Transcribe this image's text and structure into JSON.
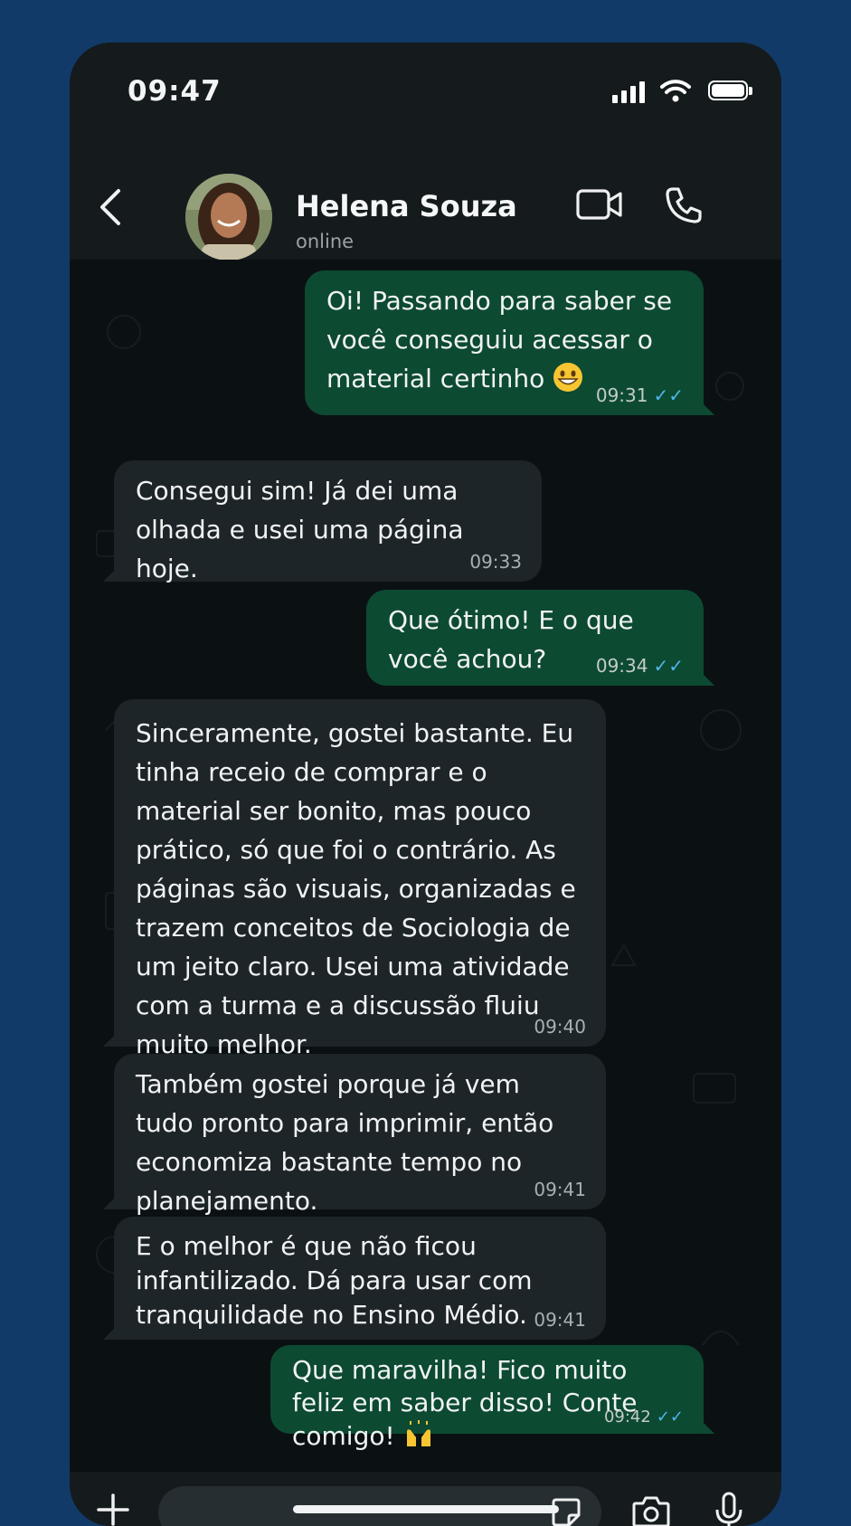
{
  "status_bar": {
    "time": "09:47"
  },
  "header": {
    "contact_name": "Helena Souza",
    "contact_status": "online"
  },
  "messages": [
    {
      "direction": "out",
      "text": "Oi! Passando para saber se você conseguiu acessar o material certinho",
      "emoji": "grinning-face",
      "time": "09:31",
      "read": true
    },
    {
      "direction": "in",
      "text": "Consegui sim! Já dei uma olhada e usei uma página hoje.",
      "time": "09:33"
    },
    {
      "direction": "out",
      "text": "Que ótimo! E o que você achou?",
      "time": "09:34",
      "read": true
    },
    {
      "direction": "in",
      "text": "Sinceramente, gostei bastante. Eu tinha receio de comprar e o material ser bonito, mas pouco prático, só que foi o contrário. As páginas são visuais, organizadas e trazem conceitos de Sociologia de um jeito claro. Usei uma atividade com a turma e a discussão fluiu muito melhor.",
      "time": "09:40"
    },
    {
      "direction": "in",
      "text": "Também gostei porque já vem tudo pronto para imprimir, então economiza bastante tempo no planejamento.",
      "time": "09:41"
    },
    {
      "direction": "in",
      "text": "E o melhor é que não ficou infantilizado. Dá para usar com tranquilidade no Ensino Médio.",
      "time": "09:41"
    },
    {
      "direction": "out",
      "text": "Que maravilha! Fico muito feliz em saber disso! Conte comigo!",
      "emoji": "raising-hands",
      "time": "09:42",
      "read": true
    }
  ],
  "colors": {
    "outgoing_bubble": "#0d4a32",
    "incoming_bubble": "#1e2528",
    "read_ticks": "#4fb6ec",
    "page_background": "#123a68"
  }
}
